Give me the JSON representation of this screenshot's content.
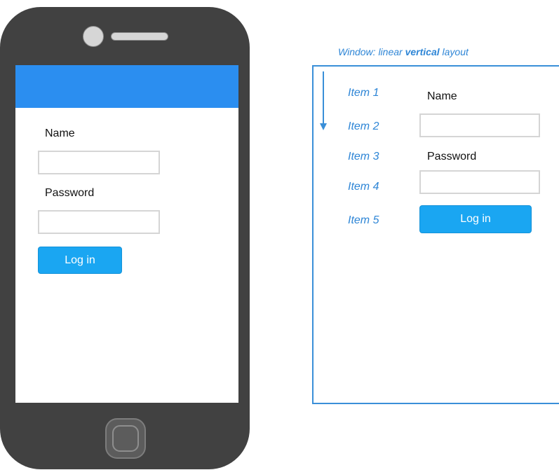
{
  "phone": {
    "name_label": "Name",
    "password_label": "Password",
    "login_button": "Log in"
  },
  "diagram": {
    "title_prefix": "Window: linear ",
    "title_emphasis": "vertical",
    "title_suffix": " layout",
    "items": [
      {
        "label": "Item 1",
        "content": "Name"
      },
      {
        "label": "Item 2",
        "content": ""
      },
      {
        "label": "Item 3",
        "content": "Password"
      },
      {
        "label": "Item 4",
        "content": ""
      },
      {
        "label": "Item 5",
        "content": "Log in"
      }
    ],
    "accent_color": "#2f86d6",
    "button_color": "#1aa6f2",
    "appbar_color": "#2b8ef0"
  }
}
